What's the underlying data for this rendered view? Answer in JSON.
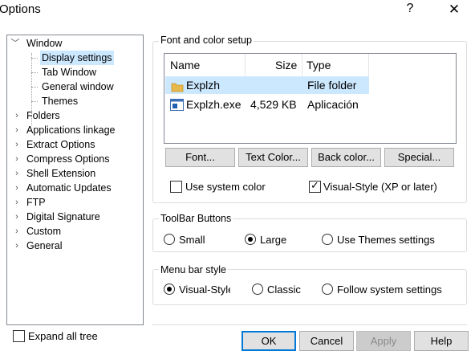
{
  "window": {
    "title": "Options",
    "help_glyph": "?",
    "close_glyph": "✕"
  },
  "tree": {
    "items": [
      {
        "label": "Window",
        "expanded": true
      },
      {
        "label": "Display settings",
        "selected": true
      },
      {
        "label": "Tab Window"
      },
      {
        "label": "General window"
      },
      {
        "label": "Themes"
      },
      {
        "label": "Folders"
      },
      {
        "label": "Applications linkage"
      },
      {
        "label": "Extract Options"
      },
      {
        "label": "Compress Options"
      },
      {
        "label": "Shell Extension"
      },
      {
        "label": "Automatic Updates"
      },
      {
        "label": "FTP"
      },
      {
        "label": "Digital Signature"
      },
      {
        "label": "Custom"
      },
      {
        "label": "General"
      }
    ],
    "expanded_glyph": "﹀",
    "collapsed_glyph": "›"
  },
  "expand_all": {
    "label": "Expand all tree",
    "checked": false
  },
  "font_color": {
    "group_title": "Font and color setup",
    "list": {
      "columns": [
        "Name",
        "Size",
        "Type"
      ],
      "rows": [
        {
          "name": "Explzh",
          "size": "",
          "type": "File folder",
          "selected": true,
          "icon": "folder-icon"
        },
        {
          "name": "Explzh.exe",
          "size": "4,529 KB",
          "type": "Aplicación",
          "selected": false,
          "icon": "application-icon"
        }
      ]
    },
    "buttons": {
      "font": "Font...",
      "text_color": "Text Color...",
      "back_color": "Back color...",
      "special": "Special..."
    },
    "use_system_color": {
      "label": "Use system color",
      "checked": false
    },
    "visual_style": {
      "label": "Visual-Style (XP or later)",
      "checked": true
    }
  },
  "toolbar_buttons": {
    "group_title": "ToolBar Buttons",
    "options": [
      {
        "label": "Small",
        "selected": false
      },
      {
        "label": "Large",
        "selected": true
      },
      {
        "label": "Use Themes settings",
        "selected": false
      }
    ]
  },
  "menu_bar_style": {
    "group_title": "Menu bar style",
    "options": [
      {
        "label": "Visual-Style",
        "selected": true
      },
      {
        "label": "Classic",
        "selected": false
      },
      {
        "label": "Follow system settings",
        "selected": false
      }
    ]
  },
  "footer": {
    "ok": "OK",
    "cancel": "Cancel",
    "apply": "Apply",
    "help": "Help",
    "apply_enabled": false
  },
  "colors": {
    "selection": "#cce8ff",
    "accent": "#0078d7",
    "folder": "#e8b84a"
  }
}
